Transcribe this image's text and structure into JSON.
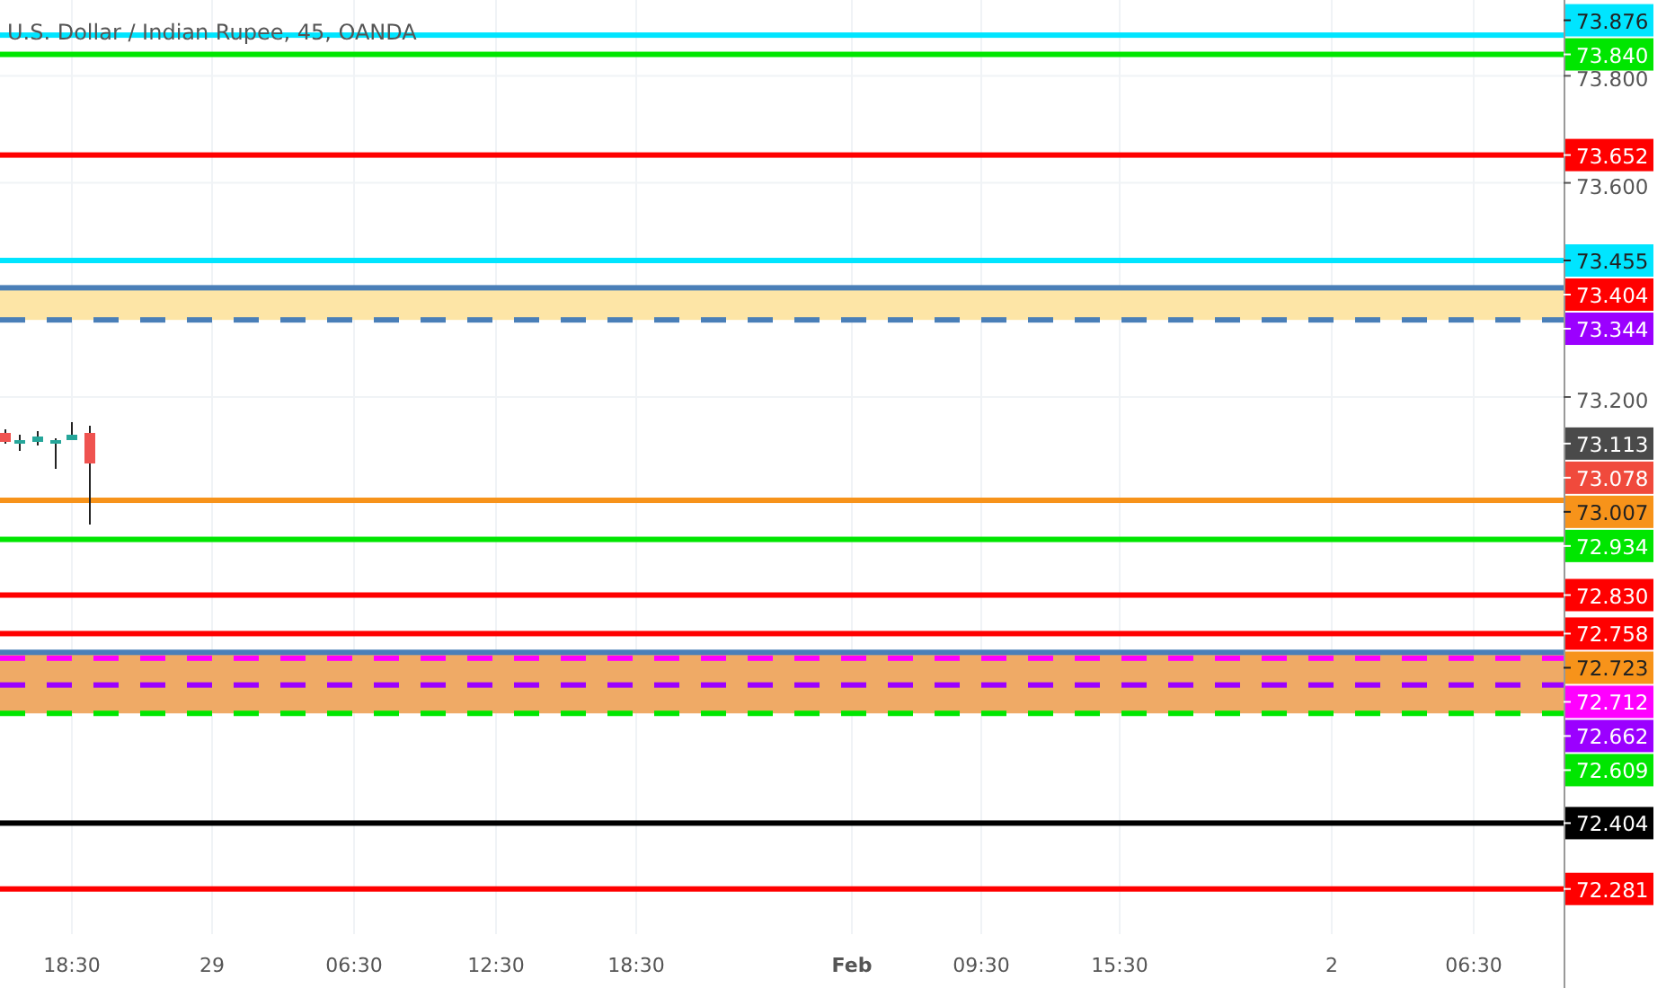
{
  "title": "U.S. Dollar / Indian Rupee, 45, OANDA",
  "price_ticks": [
    "73.800",
    "73.600",
    "73.200"
  ],
  "time_labels": [
    {
      "text": "18:30",
      "bold": false
    },
    {
      "text": "29",
      "bold": false
    },
    {
      "text": "06:30",
      "bold": false
    },
    {
      "text": "12:30",
      "bold": false
    },
    {
      "text": "18:30",
      "bold": false
    },
    {
      "text": "Feb",
      "bold": true
    },
    {
      "text": "09:30",
      "bold": false
    },
    {
      "text": "15:30",
      "bold": false
    },
    {
      "text": "2",
      "bold": false
    },
    {
      "text": "06:30",
      "bold": false
    }
  ],
  "levels": [
    {
      "label": "73.876",
      "color": "#00e5ff",
      "line": {
        "color": "#00e5ff",
        "dashed": false
      }
    },
    {
      "label": "73.840",
      "color": "#00e600",
      "line": {
        "color": "#00e600",
        "dashed": false
      }
    },
    {
      "label": "73.652",
      "color": "#ff0000",
      "line": {
        "color": "#ff0000",
        "dashed": false
      }
    },
    {
      "label": "73.455",
      "color": "#00e5ff",
      "line": {
        "color": "#00e5ff",
        "dashed": false
      }
    },
    {
      "label": "73.404",
      "color": "#ff0000",
      "line": {
        "color": "#4a7fb8",
        "dashed": false
      },
      "zone": {
        "color": "#fde5a6"
      }
    },
    {
      "label": "73.344",
      "color": "#9b00ff",
      "line": {
        "color": "#4a7fb8",
        "dashed": true
      }
    },
    {
      "label": "73.113",
      "color": "#4a4a4a"
    },
    {
      "label": "73.078",
      "color": "#f04a3c"
    },
    {
      "label": "73.007",
      "color": "#f7931a",
      "line": {
        "color": "#f7931a",
        "dashed": false
      }
    },
    {
      "label": "72.934",
      "color": "#00e600",
      "line": {
        "color": "#00e600",
        "dashed": false
      }
    },
    {
      "label": "72.830",
      "color": "#ff0000",
      "line": {
        "color": "#ff0000",
        "dashed": false
      }
    },
    {
      "label": "72.758",
      "color": "#ff0000",
      "line": {
        "color": "#ff0000",
        "dashed": false
      }
    },
    {
      "label": "72.723",
      "color": "#f7931a",
      "line": {
        "color": "#4a7fb8",
        "dashed": false
      },
      "zone": {
        "color": "#efaa66"
      }
    },
    {
      "label": "72.712",
      "color": "#ff00ff",
      "line": {
        "color": "#ff00ff",
        "dashed": true
      }
    },
    {
      "label": "72.662",
      "color": "#9b00ff",
      "line": {
        "color": "#9b00ff",
        "dashed": true
      }
    },
    {
      "label": "72.609",
      "color": "#00e600",
      "line": {
        "color": "#00e600",
        "dashed": true
      }
    },
    {
      "label": "72.404",
      "color": "#000000",
      "line": {
        "color": "#000000",
        "dashed": false
      }
    },
    {
      "label": "72.281",
      "color": "#ff0000",
      "line": {
        "color": "#ff0000",
        "dashed": false
      }
    }
  ]
}
